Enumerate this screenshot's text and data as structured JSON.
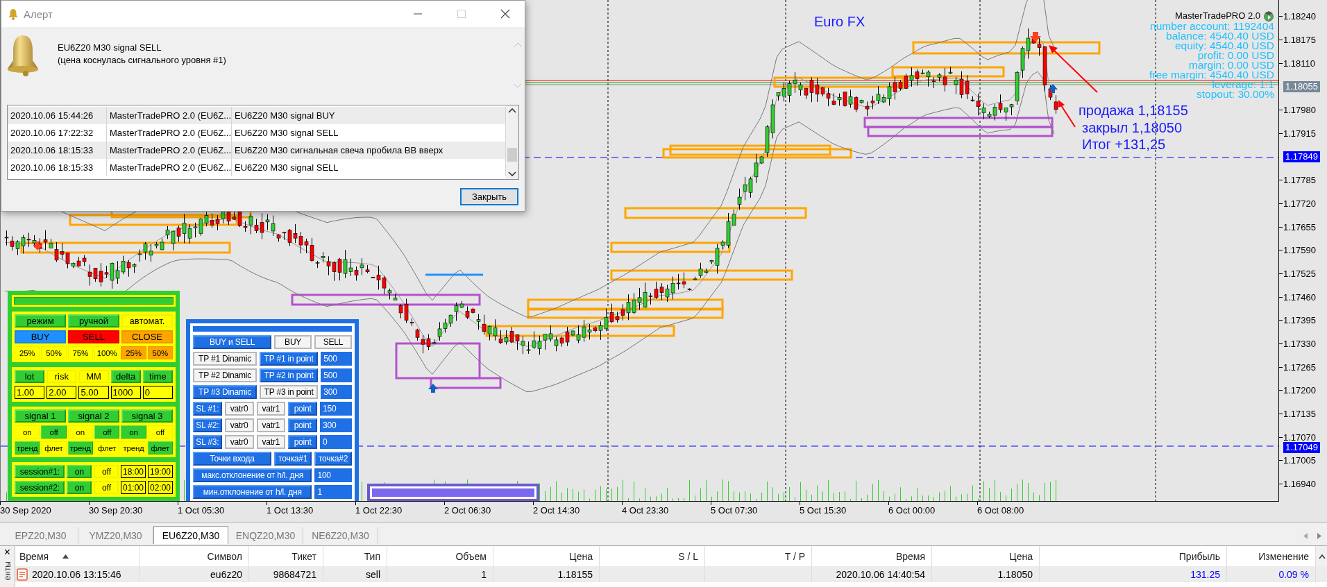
{
  "alert": {
    "title": "Алерт",
    "message": [
      "EU6Z20 M30 signal SELL",
      "(цена коснулась сигнального уровня #1)"
    ],
    "rows": [
      [
        "2020.10.06 15:44:26",
        "MasterTradePRO 2.0 (EU6Z...",
        "EU6Z20 M30 signal BUY"
      ],
      [
        "2020.10.06 17:22:32",
        "MasterTradePRO 2.0 (EU6Z...",
        "EU6Z20 M30 signal SELL"
      ],
      [
        "2020.10.06 18:15:33",
        "MasterTradePRO 2.0 (EU6Z...",
        "EU6Z20 M30 сигнальная свеча пробила BB вверх"
      ],
      [
        "2020.10.06 18:15:33",
        "MasterTradePRO 2.0 (EU6Z...",
        "EU6Z20 M30 signal SELL"
      ]
    ],
    "close_button": "Закрыть"
  },
  "chart": {
    "title": "Euro FX",
    "info_title": "MasterTradePRO 2.0",
    "info_lines": [
      "number account: 1192404",
      "balance: 4540.40 USD",
      "equity: 4540.40 USD",
      "profit: 0.00 USD",
      "margin: 0.00 USD",
      "free margin: 4540.40 USD",
      "leverage: 1:1",
      "stopout: 30.00%"
    ],
    "annotations": [
      "продажа 1,18155",
      "закрыл 1,18050",
      "Итог +131,25"
    ],
    "price_axis": [
      {
        "label": "1.18240"
      },
      {
        "label": "1.18175"
      },
      {
        "label": "1.18110"
      },
      {
        "badge": "1.18055",
        "kind": "bid"
      },
      {
        "label": "1.17980"
      },
      {
        "label": "1.17915"
      },
      {
        "badge": "1.17849",
        "kind": "level"
      },
      {
        "label": "1.17785"
      },
      {
        "label": "1.17720"
      },
      {
        "label": "1.17655"
      },
      {
        "label": "1.17590"
      },
      {
        "label": "1.17525"
      },
      {
        "label": "1.17460"
      },
      {
        "label": "1.17395"
      },
      {
        "label": "1.17330"
      },
      {
        "label": "1.17265"
      },
      {
        "label": "1.17200"
      },
      {
        "label": "1.17135"
      },
      {
        "label": "1.17070",
        "badge": "1.17049",
        "kind": "level"
      },
      {
        "label": "1.17005"
      },
      {
        "label": "1.16940"
      }
    ],
    "time_axis": [
      "30 Sep 2020",
      "30 Sep 20:30",
      "1 Oct 05:30",
      "1 Oct 13:30",
      "1 Oct 22:30",
      "2 Oct 06:30",
      "2 Oct 14:30",
      "4 Oct 23:30",
      "5 Oct 07:30",
      "5 Oct 15:30",
      "6 Oct 00:00",
      "6 Oct 08:00"
    ]
  },
  "control_panel": {
    "sections": [
      [
        [
          {
            "kind": "toggle",
            "label": "режим",
            "on": true
          },
          {
            "kind": "toggle",
            "label": "ручной",
            "on": true
          },
          {
            "kind": "toggle",
            "label": "автомат.",
            "on": false
          }
        ],
        [
          {
            "kind": "action",
            "label": "BUY",
            "color": "#1e90ff"
          },
          {
            "kind": "action",
            "label": "SELL",
            "color": "#ff0000"
          },
          {
            "kind": "action",
            "label": "CLOSE",
            "color": "#ffa500"
          }
        ],
        [
          {
            "kind": "toggle",
            "label": "25%",
            "on": false
          },
          {
            "kind": "toggle",
            "label": "50%",
            "on": false
          },
          {
            "kind": "toggle",
            "label": "75%",
            "on": false
          },
          {
            "kind": "toggle",
            "label": "100%",
            "on": false
          },
          {
            "kind": "action",
            "label": "25%",
            "color": "#ffa500"
          },
          {
            "kind": "action",
            "label": "50%",
            "color": "#ffa500"
          }
        ]
      ],
      [
        [
          {
            "kind": "toggle",
            "label": "lot",
            "on": true
          },
          {
            "kind": "toggle",
            "label": "risk",
            "on": false
          },
          {
            "kind": "toggle",
            "label": "MM",
            "on": false
          },
          {
            "kind": "toggle",
            "label": "delta",
            "on": true
          },
          {
            "kind": "toggle",
            "label": "time",
            "on": true
          }
        ],
        [
          {
            "kind": "input",
            "value": "1.00"
          },
          {
            "kind": "input",
            "value": "2.00"
          },
          {
            "kind": "input",
            "value": "5.00"
          },
          {
            "kind": "input",
            "value": "1000"
          },
          {
            "kind": "input",
            "value": "0"
          }
        ]
      ],
      [
        [
          {
            "kind": "toggle",
            "label": "signal 1",
            "on": true
          },
          {
            "kind": "toggle",
            "label": "signal 2",
            "on": true
          },
          {
            "kind": "toggle",
            "label": "signal 3",
            "on": true
          }
        ],
        [
          {
            "kind": "toggle",
            "label": "on",
            "on": false
          },
          {
            "kind": "toggle",
            "label": "off",
            "on": true
          },
          {
            "kind": "toggle",
            "label": "on",
            "on": false
          },
          {
            "kind": "toggle",
            "label": "off",
            "on": true
          },
          {
            "kind": "toggle",
            "label": "on",
            "on": true
          },
          {
            "kind": "toggle",
            "label": "off",
            "on": false
          }
        ],
        [
          {
            "kind": "toggle",
            "label": "тренд",
            "on": true
          },
          {
            "kind": "toggle",
            "label": "флет",
            "on": false
          },
          {
            "kind": "toggle",
            "label": "тренд",
            "on": true
          },
          {
            "kind": "toggle",
            "label": "флет",
            "on": false
          },
          {
            "kind": "toggle",
            "label": "тренд",
            "on": false
          },
          {
            "kind": "toggle",
            "label": "флет",
            "on": true
          }
        ]
      ],
      [
        [
          {
            "kind": "toggle",
            "label": "session#1:",
            "on": true
          },
          {
            "kind": "toggle",
            "label": "on",
            "on": true
          },
          {
            "kind": "toggle",
            "label": "off",
            "on": false
          },
          {
            "kind": "input",
            "value": "18:00"
          },
          {
            "kind": "input",
            "value": "19:00"
          }
        ],
        [
          {
            "kind": "toggle",
            "label": "session#2:",
            "on": true
          },
          {
            "kind": "toggle",
            "label": "on",
            "on": true
          },
          {
            "kind": "toggle",
            "label": "off",
            "on": false
          },
          {
            "kind": "input",
            "value": "01:00"
          },
          {
            "kind": "input",
            "value": "02:00"
          }
        ]
      ]
    ]
  },
  "order_panel": {
    "rows": [
      [
        {
          "kind": "toggle",
          "label": "BUY и SELL",
          "on": true
        },
        {
          "kind": "toggle",
          "label": "BUY",
          "on": false
        },
        {
          "kind": "toggle",
          "label": "SELL",
          "on": false
        }
      ],
      [
        {
          "kind": "toggle",
          "label": "TP #1 Dinamic",
          "on": false
        },
        {
          "kind": "toggle",
          "label": "TP #1 in point",
          "on": true
        },
        {
          "kind": "input",
          "value": "500"
        }
      ],
      [
        {
          "kind": "toggle",
          "label": "TP #2 Dinamic",
          "on": false
        },
        {
          "kind": "toggle",
          "label": "TP #2 in point",
          "on": true
        },
        {
          "kind": "input",
          "value": "500"
        }
      ],
      [
        {
          "kind": "toggle",
          "label": "TP #3 Dinamic",
          "on": true
        },
        {
          "kind": "toggle",
          "label": "TP #3 in point",
          "on": false
        },
        {
          "kind": "input",
          "value": "300"
        }
      ],
      [
        {
          "kind": "toggle",
          "label": "SL #1:",
          "on": true
        },
        {
          "kind": "toggle",
          "label": "vatr0",
          "on": false
        },
        {
          "kind": "toggle",
          "label": "vatr1",
          "on": false
        },
        {
          "kind": "toggle",
          "label": "point",
          "on": true
        },
        {
          "kind": "input",
          "value": "150"
        }
      ],
      [
        {
          "kind": "toggle",
          "label": "SL #2:",
          "on": true
        },
        {
          "kind": "toggle",
          "label": "vatr0",
          "on": false
        },
        {
          "kind": "toggle",
          "label": "vatr1",
          "on": false
        },
        {
          "kind": "toggle",
          "label": "point",
          "on": true
        },
        {
          "kind": "input",
          "value": "300"
        }
      ],
      [
        {
          "kind": "toggle",
          "label": "SL #3:",
          "on": true
        },
        {
          "kind": "toggle",
          "label": "vatr0",
          "on": false
        },
        {
          "kind": "toggle",
          "label": "vatr1",
          "on": false
        },
        {
          "kind": "toggle",
          "label": "point",
          "on": true
        },
        {
          "kind": "input",
          "value": "0"
        }
      ],
      [
        {
          "kind": "toggle",
          "label": "Точки входа",
          "on": true
        },
        {
          "kind": "toggle",
          "label": "точка#1",
          "on": true
        },
        {
          "kind": "toggle",
          "label": "точка#2",
          "on": true
        }
      ],
      [
        {
          "kind": "toggle",
          "label": "макс.отклонение от h/l. дня",
          "on": true
        },
        {
          "kind": "input",
          "value": "100"
        }
      ],
      [
        {
          "kind": "toggle",
          "label": "мин.отклонение от h/l. дня",
          "on": true
        },
        {
          "kind": "input",
          "value": "1"
        }
      ]
    ]
  },
  "tabs": [
    {
      "label": "EPZ20,M30",
      "selected": false
    },
    {
      "label": "YMZ20,M30",
      "selected": false
    },
    {
      "label": "EU6Z20,M30",
      "selected": true
    },
    {
      "label": "ENQZ20,M30",
      "selected": false
    },
    {
      "label": "NE6Z20,M30",
      "selected": false
    }
  ],
  "terminal": {
    "close": "×",
    "side_label": "енты",
    "columns": [
      "Время",
      "Символ",
      "Тикет",
      "Тип",
      "Объем",
      "Цена",
      "S / L",
      "T / P",
      "Время",
      "Цена",
      "Прибыль",
      "Изменение"
    ],
    "rows": [
      [
        "2020.10.06 13:15:46",
        "eu6z20",
        "98684721",
        "sell",
        "1",
        "1.18155",
        null,
        null,
        "2020.10.06 14:40:54",
        "1.18050",
        {
          "text": "131.25",
          "color": "#0000ff"
        },
        {
          "text": "0.09 %",
          "color": "#0000ff"
        }
      ]
    ]
  }
}
